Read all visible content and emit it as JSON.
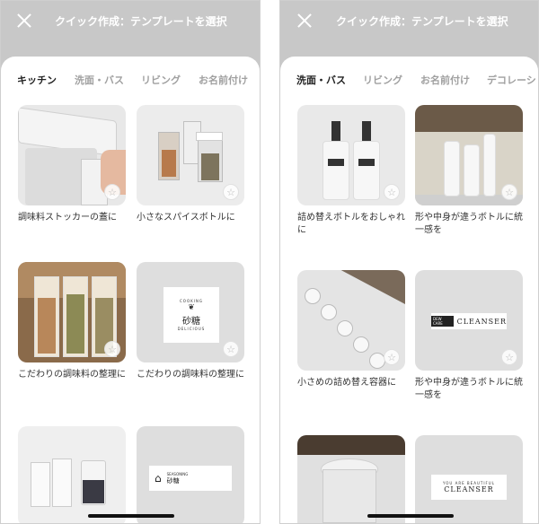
{
  "screens": [
    {
      "header": {
        "close_icon": "close-icon",
        "title": "クイック作成：テンプレートを選択"
      },
      "tabs": [
        {
          "label": "キッチン",
          "active": true
        },
        {
          "label": "洗面・バス",
          "active": false
        },
        {
          "label": "リビング",
          "active": false
        },
        {
          "label": "お名前付け",
          "active": false
        }
      ],
      "cards": [
        {
          "caption": "調味料ストッカーの蓋に"
        },
        {
          "caption": "小さなスパイスボトルに"
        },
        {
          "caption": "こだわりの調味料の整理に"
        },
        {
          "caption": "こだわりの調味料の整理に",
          "plate_top": "COOKING",
          "plate_main": "砂糖",
          "plate_bottom": "DELICIOUS"
        },
        {
          "caption": ""
        },
        {
          "caption": "",
          "plate_top": "SEASONING",
          "plate_main": "砂糖"
        }
      ]
    },
    {
      "header": {
        "close_icon": "close-icon",
        "title": "クイック作成：テンプレートを選択"
      },
      "tabs": [
        {
          "label": "洗面・バス",
          "active": true
        },
        {
          "label": "リビング",
          "active": false
        },
        {
          "label": "お名前付け",
          "active": false
        },
        {
          "label": "デコレーシ",
          "active": false
        }
      ],
      "cards": [
        {
          "caption": "詰め替えボトルをおしゃれに"
        },
        {
          "caption": "形や中身が違うボトルに統一感を"
        },
        {
          "caption": "小さめの詰め替え容器に"
        },
        {
          "caption": "形や中身が違うボトルに統一感を",
          "plate_small": "DEW CARE",
          "plate_main": "CLEANSER"
        },
        {
          "caption": ""
        },
        {
          "caption": "",
          "plate_top": "YOU ARE BEAUTIFUL",
          "plate_main": "CLEANSER"
        }
      ]
    }
  ],
  "favorite_icon": "star-outline-icon"
}
